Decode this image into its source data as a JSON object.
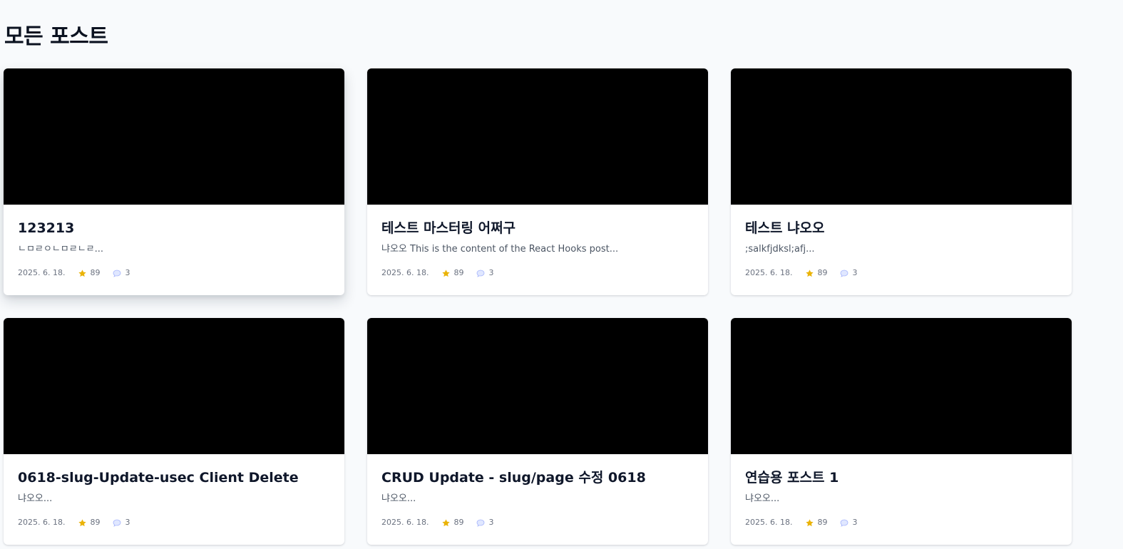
{
  "page": {
    "title": "모든 포스트"
  },
  "colors": {
    "background": "#f8fafc",
    "card": "#ffffff",
    "thumbnail": "#000000",
    "star": "#eab308",
    "comment": "#a5b4fc"
  },
  "icons": {
    "rating": "star-icon",
    "comments": "comment-icon"
  },
  "posts": [
    {
      "title": "123213",
      "excerpt": "ㄴㅁㄹㅇㄴㅁㄹㄴㄹ...",
      "date": "2025. 6. 18.",
      "stars": "89",
      "comments": "3"
    },
    {
      "title": "테스트 마스터링 어쩌구",
      "excerpt": "냐오오 This is the content of the React Hooks post...",
      "date": "2025. 6. 18.",
      "stars": "89",
      "comments": "3"
    },
    {
      "title": "테스트 냐오오",
      "excerpt": ";salkfjdksl;afj...",
      "date": "2025. 6. 18.",
      "stars": "89",
      "comments": "3"
    },
    {
      "title": "0618-slug-Update-usec Client Delete",
      "excerpt": "냐오오...",
      "date": "2025. 6. 18.",
      "stars": "89",
      "comments": "3"
    },
    {
      "title": "CRUD Update - slug/page 수정 0618",
      "excerpt": "냐오오...",
      "date": "2025. 6. 18.",
      "stars": "89",
      "comments": "3"
    },
    {
      "title": "연습용 포스트 1",
      "excerpt": "냐오오...",
      "date": "2025. 6. 18.",
      "stars": "89",
      "comments": "3"
    }
  ]
}
